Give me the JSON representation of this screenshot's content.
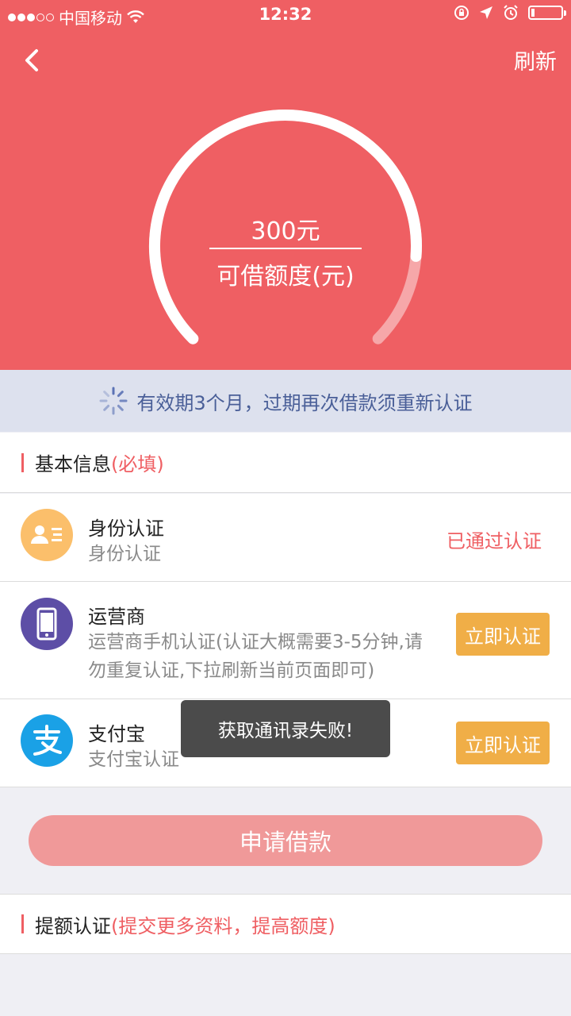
{
  "status_bar": {
    "carrier": "中国移动",
    "time": "12:32"
  },
  "nav": {
    "refresh_label": "刷新"
  },
  "gauge": {
    "amount": "300元",
    "label": "可借额度(元)",
    "progress": 0.85
  },
  "notice": {
    "text": "有效期3个月，过期再次借款须重新认证"
  },
  "basic_info": {
    "title": "基本信息",
    "required": "(必填)",
    "items": [
      {
        "title": "身份认证",
        "subtitle": "身份认证",
        "status": "已通过认证",
        "icon": "id-card-icon"
      },
      {
        "title": "运营商",
        "subtitle_line1": "运营商手机认证(认证大概需要3-5分钟,请",
        "subtitle_line2": "勿重复认证,下拉刷新当前页面即可)",
        "action": "立即认证",
        "icon": "phone-icon"
      },
      {
        "title": "支付宝",
        "subtitle": "支付宝认证",
        "action": "立即认证",
        "icon": "alipay-icon"
      }
    ]
  },
  "apply_button": "申请借款",
  "extra_section": {
    "title": "提额认证",
    "note": "(提交更多资料，提高额度)"
  },
  "toast": {
    "text": "获取通讯录失败!"
  },
  "colors": {
    "primary_red": "#ef5f63",
    "action_orange": "#f0ae47",
    "notice_blue": "#4a5f98",
    "alipay_blue": "#1aa1e6",
    "phone_purple": "#5d4ea6",
    "id_orange": "#fbbf6b"
  }
}
